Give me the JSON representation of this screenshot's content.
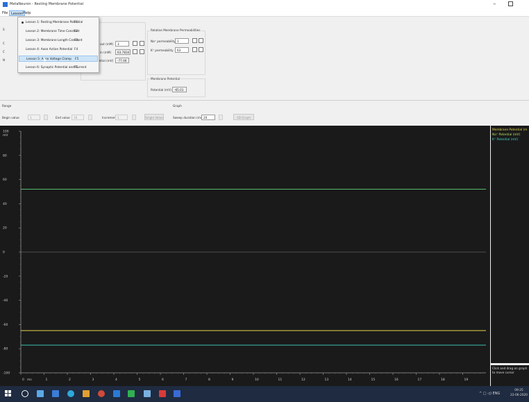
{
  "window": {
    "title": "MetaNeuron - Resting Membrane Potential",
    "minimize_glyph": "–"
  },
  "menu": {
    "file": "File",
    "lesson": "Lesson",
    "help": "Help"
  },
  "lesson_menu": [
    {
      "label": "Lesson 1: Resting Membrane Potential",
      "key": "F1",
      "checked": true
    },
    {
      "label": "Lesson 2: Membrane Time Constant",
      "key": "F2"
    },
    {
      "label": "Lesson 3: Membrane Length Constant",
      "key": "F3"
    },
    {
      "label": "Lesson 4: Axon Action Potential",
      "key": "F4"
    },
    {
      "label": "Lesson 5: Axon Voltage Clamp",
      "key": "F5",
      "hovered": true
    },
    {
      "label": "Lesson 6: Synaptic Potential and Current",
      "key": "F6"
    }
  ],
  "hidden_left_letters": [
    "S",
    "C",
    "C",
    "N"
  ],
  "concentrations": {
    "out_label": "n out (mM)",
    "out_value": "3",
    "in_label": "n in (mM)",
    "in_value": "63.7834",
    "pot_label": "ential (mV)",
    "pot_value": "-77.06"
  },
  "permeabilities": {
    "title": "Relative Membrane Permeabilities",
    "na_label": "Na⁺ permeability",
    "na_value": "1",
    "k_label": "K⁺ permeability",
    "k_value": "63"
  },
  "membrane_potential": {
    "title": "Membrane Potential",
    "label": "Potential (mV)",
    "value": "-65.01"
  },
  "range": {
    "title": "Range",
    "begin_label": "Begin value",
    "begin_value": "1",
    "end_label": "End value",
    "end_value": "10",
    "inc_label": "Increment",
    "inc_value": "1",
    "single_button": "Single Value"
  },
  "graph_controls": {
    "title": "Graph",
    "sweep_label": "Sweep duration (ms)",
    "sweep_value": "20",
    "graph_button": "3D Graph"
  },
  "legend": [
    {
      "label": "Membrane Potential (m",
      "color": "#e8d84a"
    },
    {
      "label": "Na⁺ Potential (mV)",
      "color": "#b8e060"
    },
    {
      "label": "K⁺ Potential (mV)",
      "color": "#40d8c8"
    }
  ],
  "hint": "Click and drag on graph to move cursor",
  "chart_data": {
    "type": "line",
    "ylabel": "mV",
    "xlabel": "ms",
    "ylim": [
      -100,
      100
    ],
    "xlim": [
      0,
      20
    ],
    "y_ticks": [
      100,
      80,
      60,
      40,
      20,
      0,
      -20,
      -40,
      -60,
      -80,
      -100
    ],
    "x_ticks": [
      0,
      1,
      2,
      3,
      4,
      5,
      6,
      7,
      8,
      9,
      10,
      11,
      12,
      13,
      14,
      15,
      16,
      17,
      18,
      19
    ],
    "series": [
      {
        "name": "Membrane Potential (m",
        "color": "#e8d84a",
        "values": [
          -65.01,
          -65.01
        ]
      },
      {
        "name": "Na⁺ Potential (mV)",
        "color": "#5fd07a",
        "values": [
          52,
          52
        ]
      },
      {
        "name": "K⁺ Potential (mV)",
        "color": "#40d8c8",
        "values": [
          -77.06,
          -77.06
        ]
      }
    ],
    "zero_line_color": "#808080"
  },
  "taskbar": {
    "tray": "^ □ ◁) ENG",
    "time": "09:25",
    "date": "22-06-2020"
  }
}
